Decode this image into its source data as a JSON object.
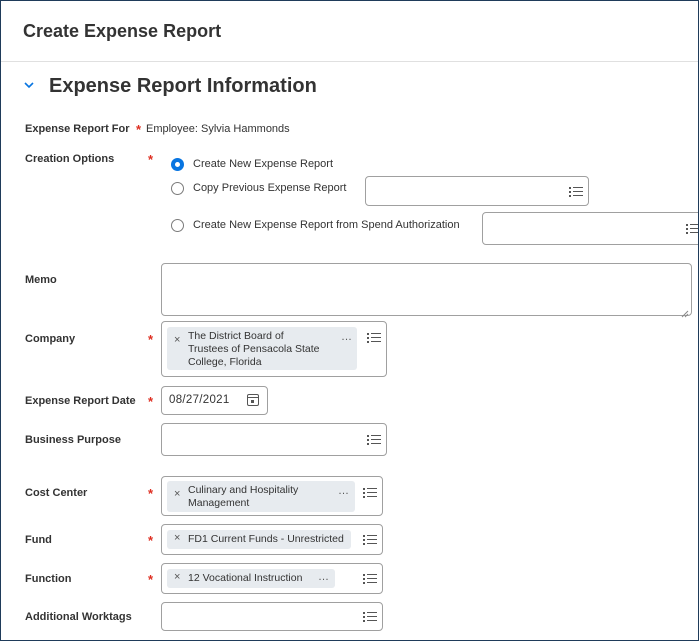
{
  "page": {
    "title": "Create Expense Report"
  },
  "section": {
    "title": "Expense Report Information"
  },
  "fields": {
    "report_for": {
      "label": "Expense Report For",
      "value": "Employee: Sylvia Hammonds"
    },
    "creation_options": {
      "label": "Creation Options",
      "options": [
        {
          "label": "Create New Expense Report",
          "selected": true
        },
        {
          "label": "Copy Previous Expense Report",
          "selected": false
        },
        {
          "label": "Create New Expense Report from Spend Authorization",
          "selected": false
        }
      ]
    },
    "memo": {
      "label": "Memo",
      "value": ""
    },
    "company": {
      "label": "Company",
      "value": "The District Board of Trustees of Pensacola State College, Florida",
      "line1": "The District Board of",
      "line2": "Trustees of Pensacola State",
      "line3": "College, Florida"
    },
    "report_date": {
      "label": "Expense Report Date",
      "value": "08/27/2021"
    },
    "business_purpose": {
      "label": "Business Purpose",
      "value": ""
    },
    "cost_center": {
      "label": "Cost Center",
      "value": "Culinary and Hospitality Management",
      "line1": "Culinary and Hospitality",
      "line2": "Management"
    },
    "fund": {
      "label": "Fund",
      "value": "FD1 Current Funds - Unrestricted"
    },
    "function": {
      "label": "Function",
      "value": "12 Vocational Instruction"
    },
    "additional_worktags": {
      "label": "Additional Worktags",
      "value": ""
    }
  },
  "icons": {
    "more": "…",
    "remove": "×",
    "expand": "chevron-down-icon",
    "prompt": "list-icon",
    "calendar": "calendar-icon"
  },
  "colors": {
    "accent": "#0875e1",
    "required": "#de2e21",
    "border": "#a0a0a0",
    "pill": "#e7ebef"
  }
}
